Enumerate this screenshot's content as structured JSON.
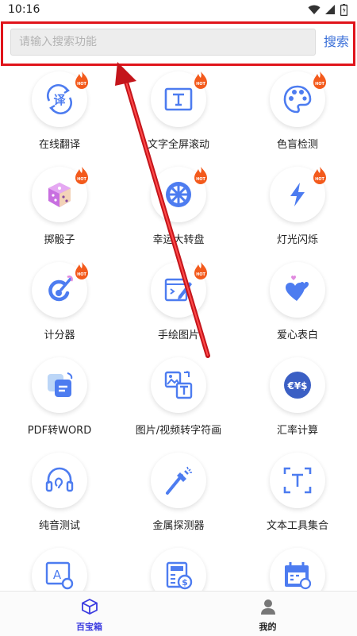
{
  "status": {
    "time": "10:16"
  },
  "search": {
    "placeholder": "请输入搜索功能",
    "button": "搜索"
  },
  "tools": [
    {
      "label": "在线翻译",
      "icon": "translate-icon",
      "hot": true
    },
    {
      "label": "文字全屏滚动",
      "icon": "text-scroll-icon",
      "hot": true
    },
    {
      "label": "色盲检测",
      "icon": "palette-icon",
      "hot": true
    },
    {
      "label": "掷骰子",
      "icon": "dice-icon",
      "hot": true
    },
    {
      "label": "幸运大转盘",
      "icon": "wheel-icon",
      "hot": true
    },
    {
      "label": "灯光闪烁",
      "icon": "lightning-icon",
      "hot": true
    },
    {
      "label": "计分器",
      "icon": "score-icon",
      "hot": true
    },
    {
      "label": "手绘图片",
      "icon": "drawing-icon",
      "hot": true
    },
    {
      "label": "爱心表白",
      "icon": "hearts-icon",
      "hot": false
    },
    {
      "label": "PDF转WORD",
      "icon": "pdf-word-icon",
      "hot": false
    },
    {
      "label": "图片/视频转字符画",
      "icon": "image-text-icon",
      "hot": false
    },
    {
      "label": "汇率计算",
      "icon": "exchange-icon",
      "hot": false
    },
    {
      "label": "纯音测试",
      "icon": "headphones-icon",
      "hot": false
    },
    {
      "label": "金属探测器",
      "icon": "metal-detector-icon",
      "hot": false
    },
    {
      "label": "文本工具集合",
      "icon": "text-tools-icon",
      "hot": false
    },
    {
      "label": "",
      "icon": "font-settings-icon",
      "hot": false
    },
    {
      "label": "",
      "icon": "calculator-icon",
      "hot": false
    },
    {
      "label": "",
      "icon": "calendar-icon",
      "hot": false
    }
  ],
  "tabs": [
    {
      "label": "百宝箱",
      "icon": "cube-icon",
      "active": true
    },
    {
      "label": "我的",
      "icon": "person-icon",
      "active": false
    }
  ],
  "colors": {
    "accent": "#3a6fd8",
    "icon_blue": "#4d7cf0",
    "highlight": "#e0141b",
    "active_tab": "#3b3be0"
  }
}
